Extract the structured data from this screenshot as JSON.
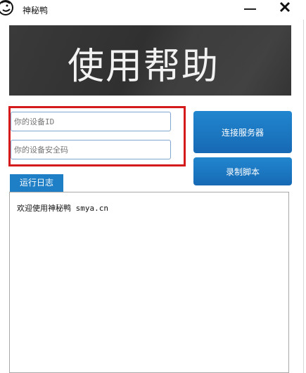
{
  "window": {
    "title": "神秘鸭",
    "minimize_icon": "minimize-icon",
    "close_icon": "close-icon"
  },
  "banner": {
    "title": "使用帮助"
  },
  "form": {
    "device_id_placeholder": "你的设备ID",
    "security_code_placeholder": "你的设备安全码"
  },
  "buttons": {
    "connect": "连接服务器",
    "record": "录制脚本"
  },
  "log": {
    "tab_label": "运行日志",
    "lines": [
      "欢迎使用神秘鸭 smya.cn"
    ]
  },
  "colors": {
    "accent": "#1f7fc6",
    "highlight": "#d41a1a",
    "banner_bg": "#353535"
  }
}
